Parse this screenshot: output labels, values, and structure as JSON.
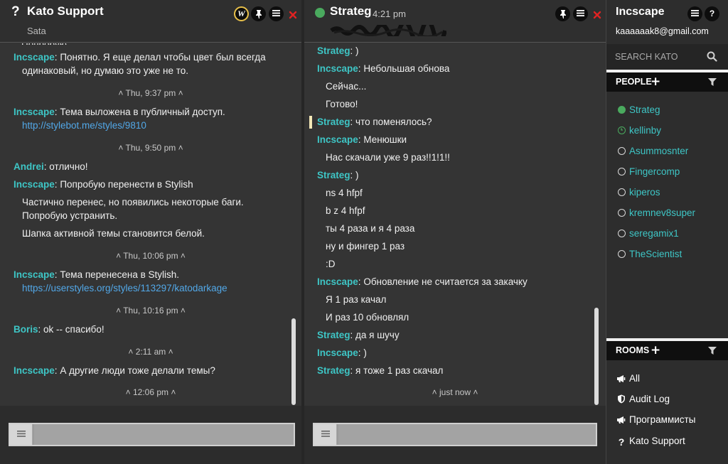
{
  "colors": {
    "author": "#3ec6c6",
    "link": "#52a8e8",
    "online": "#4aaa5e",
    "close": "#e02222",
    "w_ring": "#e8c04a"
  },
  "pane_left": {
    "title": "Kato Support",
    "subtitle": "Sata",
    "title_icon": "question-mark-icon",
    "w_label": "W",
    "messages": [
      {
        "type": "msg",
        "author": "Incscape",
        "text": "Понятно. Я еще делал чтобы цвет был всегда"
      },
      {
        "type": "cont",
        "text": "одинаковый, но думаю это уже не то."
      },
      {
        "type": "sep",
        "text": "Thu, 9:37 pm"
      },
      {
        "type": "msg",
        "author": "Incscape",
        "text": "Тема выложена в публичный доступ."
      },
      {
        "type": "link",
        "text": "http://stylebot.me/styles/9810"
      },
      {
        "type": "sep",
        "text": "Thu, 9:50 pm"
      },
      {
        "type": "msg",
        "author": "Andrei",
        "text": "отлично!"
      },
      {
        "type": "msg",
        "author": "Incscape",
        "text": "Попробую перенести в Stylish"
      },
      {
        "type": "cont",
        "text": "Частично перенес, но появились некоторые баги."
      },
      {
        "type": "cont",
        "text": "Попробую устранить."
      },
      {
        "type": "cont",
        "text": "Шапка активной темы становится белой."
      },
      {
        "type": "sep",
        "text": "Thu, 10:06 pm"
      },
      {
        "type": "msg",
        "author": "Incscape",
        "text": "Тема перенесена в Stylish."
      },
      {
        "type": "link",
        "text": "https://userstyles.org/styles/113297/katodarkage"
      },
      {
        "type": "sep",
        "text": "Thu, 10:16 pm"
      },
      {
        "type": "msg",
        "author": "Boris",
        "text": "ok -- спасибо!"
      },
      {
        "type": "sep",
        "text": "2:11 am"
      },
      {
        "type": "msg",
        "author": "Incscape",
        "text": "А другие люди тоже делали темы?"
      },
      {
        "type": "sep",
        "text": "12:06 pm"
      }
    ],
    "input_placeholder": ""
  },
  "pane_right": {
    "title": "Strateg",
    "time": "4:21 pm",
    "messages": [
      {
        "type": "msg",
        "author": "Strateg",
        "text": ")"
      },
      {
        "type": "msg",
        "author": "Incscape",
        "text": "Небольшая обнова"
      },
      {
        "type": "cont",
        "text": "Сейчас..."
      },
      {
        "type": "cont",
        "text": "Готово!"
      },
      {
        "type": "msg",
        "author": "Strateg",
        "text": "что поменялось?",
        "marker": true
      },
      {
        "type": "msg",
        "author": "Incscape",
        "text": "Менюшки"
      },
      {
        "type": "cont",
        "text": "Нас скачали уже 9 раз!!1!1!!"
      },
      {
        "type": "msg",
        "author": "Strateg",
        "text": ")"
      },
      {
        "type": "cont",
        "text": "ns 4 hfpf"
      },
      {
        "type": "cont",
        "text": "b z 4 hfpf"
      },
      {
        "type": "cont",
        "text": "ты 4 раза и я 4 раза"
      },
      {
        "type": "cont",
        "text": "ну и фингер 1 раз"
      },
      {
        "type": "cont",
        "text": ":D"
      },
      {
        "type": "msg",
        "author": "Incscape",
        "text": "Обновление не считается за закачку"
      },
      {
        "type": "cont",
        "text": "Я 1 раз качал"
      },
      {
        "type": "cont",
        "text": "И раз 10 обновлял"
      },
      {
        "type": "msg",
        "author": "Strateg",
        "text": "да я шучу"
      },
      {
        "type": "msg",
        "author": "Incscape",
        "text": ")"
      },
      {
        "type": "msg",
        "author": "Strateg",
        "text": "я тоже 1 раз скачал"
      },
      {
        "type": "sep",
        "text": "just now"
      }
    ],
    "input_placeholder": ""
  },
  "sidebar": {
    "user": "Incscape",
    "email": "kaaaaaak8@gmail.com",
    "search_placeholder": "SEARCH KATO",
    "people_label": "PEOPLE",
    "people": [
      {
        "name": "Strateg",
        "status": "online"
      },
      {
        "name": "kellinby",
        "status": "idle"
      },
      {
        "name": "Asummosnter",
        "status": "offline"
      },
      {
        "name": "Fingercomp",
        "status": "offline"
      },
      {
        "name": "kiperos",
        "status": "offline"
      },
      {
        "name": "kremnev8super",
        "status": "offline"
      },
      {
        "name": "seregamix1",
        "status": "offline"
      },
      {
        "name": "TheScientist",
        "status": "offline"
      }
    ],
    "rooms_label": "ROOMS",
    "rooms": [
      {
        "name": "All",
        "icon": "megaphone-icon"
      },
      {
        "name": "Audit Log",
        "icon": "shield-icon"
      },
      {
        "name": "Программисты",
        "icon": "megaphone-icon"
      },
      {
        "name": "Kato Support",
        "icon": "question-mark-icon"
      }
    ]
  }
}
